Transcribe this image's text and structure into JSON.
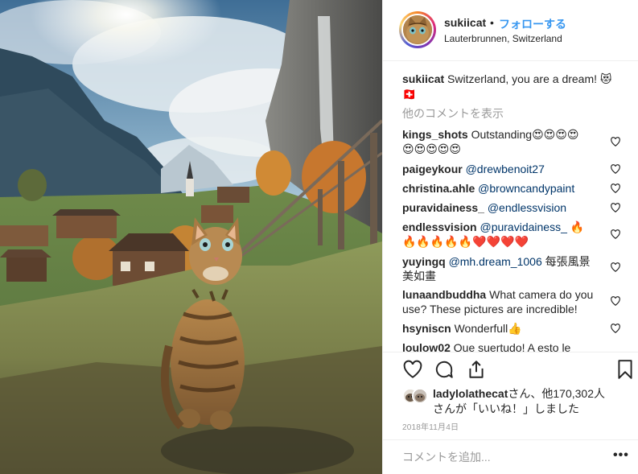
{
  "post": {
    "username": "sukiicat",
    "separator": "•",
    "follow_label": "フォローする",
    "location": "Lauterbrunnen, Switzerland"
  },
  "caption": {
    "username": "sukiicat",
    "text": "Switzerland, you are a dream! 😻",
    "flag": "🇨🇭"
  },
  "view_more_label": "他のコメントを表示",
  "comments": [
    {
      "username": "kings_shots",
      "text": "Outstanding😍😍😍😍",
      "text2": "😍😍😍😍😍"
    },
    {
      "username": "paigeykour",
      "mention": "@drewbenoit27"
    },
    {
      "username": "christina.ahle",
      "mention": "@browncandypaint"
    },
    {
      "username": "puravidainess_",
      "mention": "@endlessvision"
    },
    {
      "username": "endlessvision",
      "mention": "@puravidainess_",
      "text": " 🔥",
      "text2": "🔥🔥🔥🔥🔥❤️❤️❤️❤️"
    },
    {
      "username": "yuyingq",
      "mention": "@mh.dream_1006",
      "text": " 每張風景",
      "text2": "美如畫"
    },
    {
      "username": "lunaandbuddha",
      "text": "What camera do you",
      "text2": "use? These pictures are incredible!"
    },
    {
      "username": "hsyniscn",
      "text": "Wonderfull👍"
    },
    {
      "username": "loulow02",
      "text": "Que suertudo! A esto le"
    }
  ],
  "likes": {
    "username": "ladylolathecat",
    "line1_suffix": "さん、他170,302人",
    "line2": "さんが「いいね！」しました"
  },
  "date": "2018年11月4日",
  "add_comment": {
    "placeholder": "コメントを追加...",
    "more": "•••"
  },
  "icons": {
    "like": "heart-icon",
    "comment": "comment-icon",
    "share": "share-icon",
    "save": "bookmark-icon"
  },
  "colors": {
    "link": "#3897f0",
    "mention": "#003569",
    "muted": "#999999",
    "text": "#262626"
  }
}
